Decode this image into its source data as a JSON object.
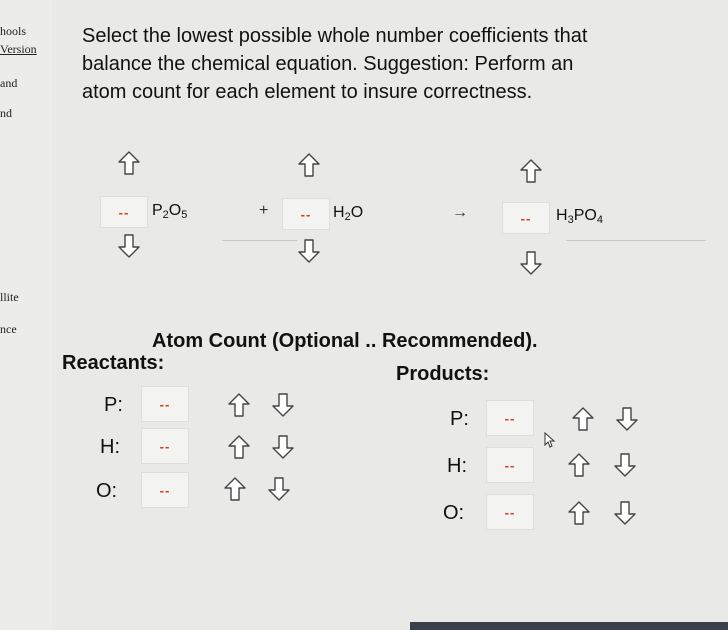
{
  "sidebar": {
    "items": [
      "hools",
      "Version",
      "and",
      "nd",
      "llite",
      "nce"
    ]
  },
  "prompt": {
    "line1": "Select the lowest possible whole number coefficients that",
    "line2": "balance the chemical equation.   Suggestion: Perform an",
    "line3": "atom count for each element to insure correctness."
  },
  "equation": {
    "reactant1": {
      "coefficient": "--",
      "formula_main": "P",
      "sub1": "2",
      "formula_mid": "O",
      "sub2": "5"
    },
    "plus": "+",
    "reactant2": {
      "coefficient": "--",
      "formula_main": "H",
      "sub1": "2",
      "formula_mid": "O"
    },
    "arrow": "→",
    "product1": {
      "coefficient": "--",
      "formula_main": "H",
      "sub1": "3",
      "formula_mid": "PO",
      "sub2": "4"
    }
  },
  "atom_count": {
    "title": "Atom Count (Optional .. Recommended).",
    "reactants_label": "Reactants:",
    "products_label": "Products:",
    "reactants": [
      {
        "element": "P:",
        "value": "--"
      },
      {
        "element": "H:",
        "value": "--"
      },
      {
        "element": "O:",
        "value": "--"
      }
    ],
    "products": [
      {
        "element": "P:",
        "value": "--"
      },
      {
        "element": "H:",
        "value": "--"
      },
      {
        "element": "O:",
        "value": "--"
      }
    ]
  },
  "colors": {
    "placeholder_red": "#d23c2c",
    "box_bg": "#f3f3f1",
    "page_bg": "#e9e9e7"
  },
  "icons": {
    "up": "arrow-up-outline-icon",
    "down": "arrow-down-outline-icon"
  }
}
